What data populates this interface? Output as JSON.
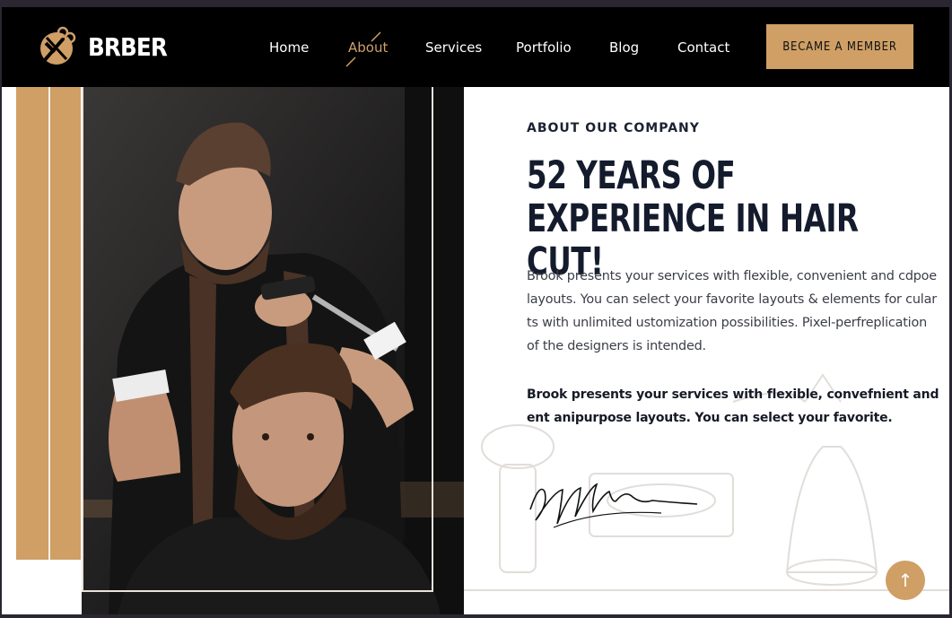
{
  "brand": {
    "name": "BRBER",
    "logo_icon": "scissors-comb-icon"
  },
  "nav": {
    "items": [
      {
        "label": "Home",
        "active": false
      },
      {
        "label": "About",
        "active": true
      },
      {
        "label": "Services",
        "active": false
      },
      {
        "label": "Portfolio",
        "active": false
      },
      {
        "label": "Blog",
        "active": false
      },
      {
        "label": "Contact",
        "active": false
      }
    ],
    "cta_label": "BECAME A MEMBER"
  },
  "about": {
    "eyebrow": "ABOUT OUR COMPANY",
    "title": "52 YEARS OF EXPERIENCE IN HAIR CUT!",
    "paragraph1": "Brook presents your services with flexible, convenient and cdpoe layouts. You can select your favorite layouts & elements for cular ts with unlimited ustomization possibilities. Pixel-perfreplication of the designers is intended.",
    "paragraph2": "Brook presents your services with flexible, convefnient and ent anipurpose layouts. You can select your favorite."
  },
  "scroll_top_icon": "arrow-up-icon",
  "colors": {
    "accent": "#cf9f66",
    "header_bg": "#000000",
    "heading": "#141b2d"
  }
}
